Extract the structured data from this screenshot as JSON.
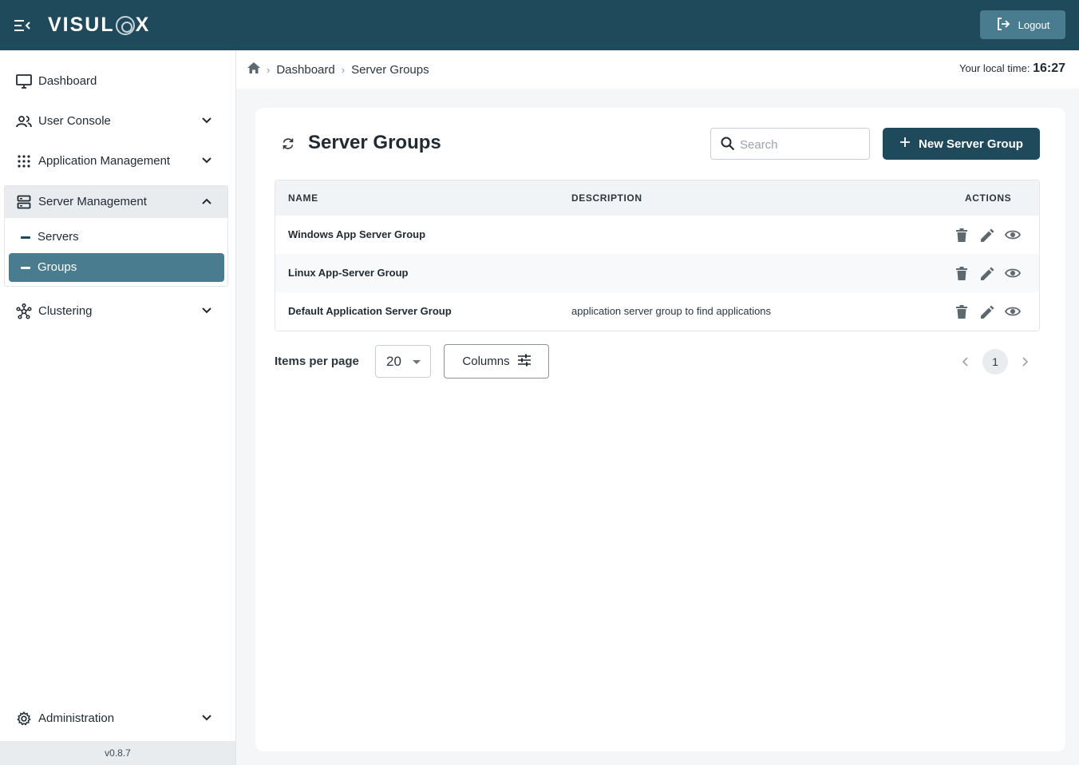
{
  "app": {
    "logo_text_left": "VISUL",
    "logo_text_right": "X",
    "version": "v0.8.7"
  },
  "topbar": {
    "logout_label": "Logout"
  },
  "sidebar": {
    "items": [
      {
        "label": "Dashboard",
        "icon": "monitor-icon"
      },
      {
        "label": "User Console",
        "icon": "users-icon"
      },
      {
        "label": "Application Management",
        "icon": "apps-grid-icon"
      },
      {
        "label": "Server Management",
        "icon": "server-icon",
        "expanded": true
      },
      {
        "label": "Clustering",
        "icon": "cluster-icon"
      },
      {
        "label": "Administration",
        "icon": "gear-icon"
      }
    ],
    "server_sub": [
      {
        "label": "Servers"
      },
      {
        "label": "Groups",
        "active": true
      }
    ]
  },
  "breadcrumb": {
    "items": [
      "Dashboard",
      "Server Groups"
    ]
  },
  "localtime": {
    "label": "Your local time:",
    "value": "16:27"
  },
  "main": {
    "title": "Server Groups",
    "search_placeholder": "Search",
    "new_button_label": "New Server Group"
  },
  "table": {
    "headers": [
      "NAME",
      "DESCRIPTION",
      "ACTIONS"
    ],
    "rows": [
      {
        "name": "Windows App Server Group",
        "description": ""
      },
      {
        "name": "Linux App-Server Group",
        "description": ""
      },
      {
        "name": "Default Application Server Group",
        "description": "application server group to find applications"
      }
    ]
  },
  "pagination": {
    "items_per_page_label": "Items per page",
    "items_per_page_value": "20",
    "columns_label": "Columns",
    "current_page": "1"
  },
  "colors": {
    "primary": "#1e4a5c",
    "active": "#4a7c8f"
  }
}
